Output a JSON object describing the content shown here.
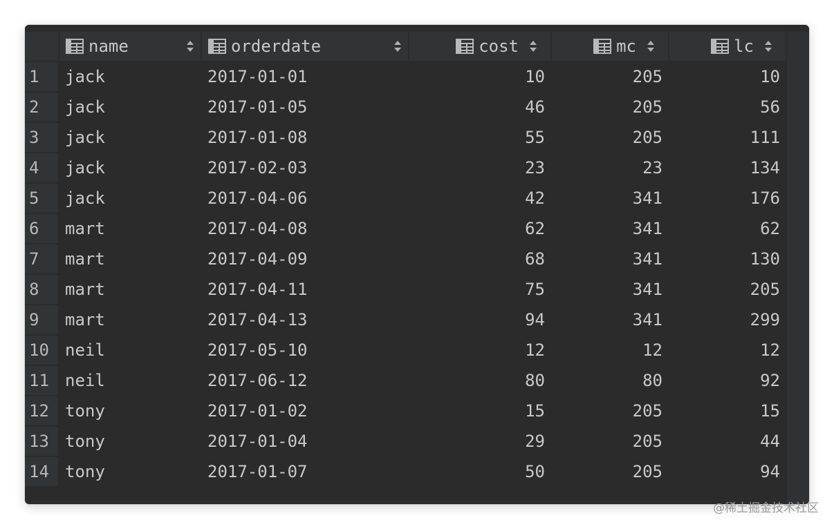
{
  "columns": [
    {
      "key": "name",
      "label": "name",
      "align": "left"
    },
    {
      "key": "orderdate",
      "label": "orderdate",
      "align": "left"
    },
    {
      "key": "cost",
      "label": "cost",
      "align": "right"
    },
    {
      "key": "mc",
      "label": "mc",
      "align": "right"
    },
    {
      "key": "lc",
      "label": "lc",
      "align": "right"
    }
  ],
  "rows": [
    {
      "num": "1",
      "name": "jack",
      "orderdate": "2017-01-01",
      "cost": "10",
      "mc": "205",
      "lc": "10"
    },
    {
      "num": "2",
      "name": "jack",
      "orderdate": "2017-01-05",
      "cost": "46",
      "mc": "205",
      "lc": "56"
    },
    {
      "num": "3",
      "name": "jack",
      "orderdate": "2017-01-08",
      "cost": "55",
      "mc": "205",
      "lc": "111"
    },
    {
      "num": "4",
      "name": "jack",
      "orderdate": "2017-02-03",
      "cost": "23",
      "mc": "23",
      "lc": "134"
    },
    {
      "num": "5",
      "name": "jack",
      "orderdate": "2017-04-06",
      "cost": "42",
      "mc": "341",
      "lc": "176"
    },
    {
      "num": "6",
      "name": "mart",
      "orderdate": "2017-04-08",
      "cost": "62",
      "mc": "341",
      "lc": "62"
    },
    {
      "num": "7",
      "name": "mart",
      "orderdate": "2017-04-09",
      "cost": "68",
      "mc": "341",
      "lc": "130"
    },
    {
      "num": "8",
      "name": "mart",
      "orderdate": "2017-04-11",
      "cost": "75",
      "mc": "341",
      "lc": "205"
    },
    {
      "num": "9",
      "name": "mart",
      "orderdate": "2017-04-13",
      "cost": "94",
      "mc": "341",
      "lc": "299"
    },
    {
      "num": "10",
      "name": "neil",
      "orderdate": "2017-05-10",
      "cost": "12",
      "mc": "12",
      "lc": "12"
    },
    {
      "num": "11",
      "name": "neil",
      "orderdate": "2017-06-12",
      "cost": "80",
      "mc": "80",
      "lc": "92"
    },
    {
      "num": "12",
      "name": "tony",
      "orderdate": "2017-01-02",
      "cost": "15",
      "mc": "205",
      "lc": "15"
    },
    {
      "num": "13",
      "name": "tony",
      "orderdate": "2017-01-04",
      "cost": "29",
      "mc": "205",
      "lc": "44"
    },
    {
      "num": "14",
      "name": "tony",
      "orderdate": "2017-01-07",
      "cost": "50",
      "mc": "205",
      "lc": "94"
    }
  ],
  "icons": {
    "column_icon": "table-column-icon",
    "sort_icon": "sort-updown-icon"
  },
  "colors": {
    "background": "#2b2b2b",
    "header_bg": "#313335",
    "text": "#c9c9c9"
  },
  "watermark": "@稀土掘金技术社区"
}
